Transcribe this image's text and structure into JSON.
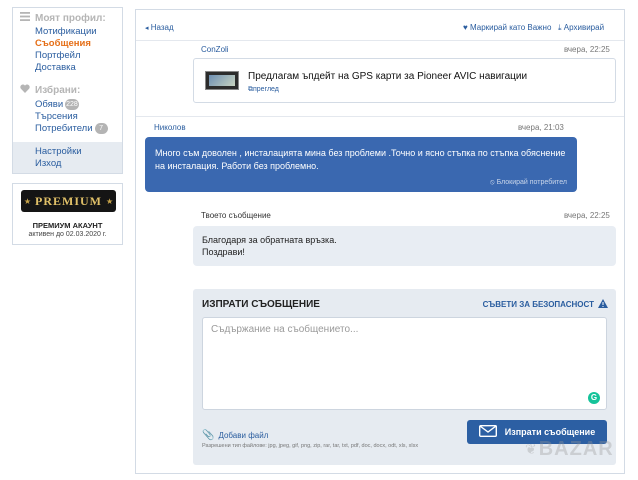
{
  "sidebar": {
    "profile_heading": "Моят профил:",
    "profile_items": [
      "Мотификации",
      "Съобщения",
      "Портфейл",
      "Доставка"
    ],
    "favorites_heading": "Избрани:",
    "favorites_items": [
      {
        "label": "Обяви",
        "badge": "228"
      },
      {
        "label": "Търсения",
        "badge": ""
      },
      {
        "label": "Потребители",
        "badge": "7"
      }
    ],
    "settings_items": [
      "Настройки",
      "Изход"
    ],
    "premium": {
      "logo_text": "PREMIUM",
      "title": "ПРЕМИУМ АКАУНТ",
      "subtitle": "активен до 02.03.2020 г."
    }
  },
  "toolbar": {
    "back": "Назад",
    "mark_important": "Маркирай като Важно",
    "archive": "Архивирай"
  },
  "conversation": {
    "ad": {
      "sender": "ConZoli",
      "time": "вчера, 22:25",
      "title": "Предлагам ъпдейт на GPS карти за Pioneer AVIC навигации",
      "view_link": "преглед"
    },
    "incoming": {
      "sender": "Николов",
      "time": "вчера, 21:03",
      "text": "Много съм доволен , инсталацията мина без проблеми .Точно и ясно стъпка по стъпка обяснение на инсталация. Работи без проблемно.",
      "block_link": "Блокирай потребител"
    },
    "outgoing": {
      "label": "Твоето съобщение",
      "time": "вчера, 22:25",
      "line1": "Благодаря за обратната връзка.",
      "line2": "Поздрави!"
    }
  },
  "compose": {
    "heading": "ИЗПРАТИ СЪОБЩЕНИЕ",
    "safety_link": "СЪВЕТИ ЗА БЕЗОПАСНОСТ",
    "placeholder": "Съдържание на съобщението...",
    "attach_label": "Добави файл",
    "allowed_types": "Разрешени тип файлове: jpg, jpeg, gif, png, zip, rar, tar, txt, pdf, doc, docx, odt, xls, xlsx",
    "send_label": "Изпрати съобщение"
  },
  "watermark": "BAZAR",
  "colors": {
    "accent": "#2c5fa3",
    "active_link": "#e56e16",
    "message_blue": "#3a68b0"
  }
}
